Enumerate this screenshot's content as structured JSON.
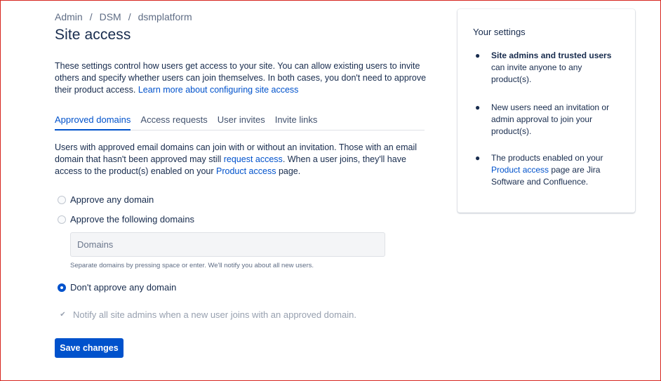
{
  "breadcrumb": [
    "Admin",
    "DSM",
    "dsmplatform"
  ],
  "breadcrumb_separator": "/",
  "page_title": "Site access",
  "intro": {
    "text": "These settings control how users get access to your site. You can allow existing users to invite others and specify whether users can join themselves. In both cases, you don't need to approve their product access. ",
    "link": "Learn more about configuring site access"
  },
  "tabs": [
    {
      "label": "Approved domains",
      "active": true
    },
    {
      "label": "Access requests",
      "active": false
    },
    {
      "label": "User invites",
      "active": false
    },
    {
      "label": "Invite links",
      "active": false
    }
  ],
  "description": {
    "part1": "Users with approved email domains can join with or without an invitation. Those with an email domain that hasn't been approved may still ",
    "link1": "request access",
    "part2": ". When a user joins, they'll have access to the product(s) enabled on your ",
    "link2": "Product access",
    "part3": " page."
  },
  "options": {
    "any_domain": {
      "label": "Approve any domain",
      "checked": false
    },
    "following_domains": {
      "label": "Approve the following domains",
      "checked": false
    },
    "no_domain": {
      "label": "Don't approve any domain",
      "checked": true
    }
  },
  "domains_input": {
    "placeholder": "Domains",
    "value": ""
  },
  "domains_helper": "Separate domains by pressing space or enter. We'll notify you about all new users.",
  "notify_checkbox": {
    "label": "Notify all site admins when a new user joins with an approved domain.",
    "checked": true,
    "disabled": true
  },
  "save_button": "Save changes",
  "settings_panel": {
    "title": "Your settings",
    "item1_bold": "Site admins and trusted users",
    "item1_rest": " can invite anyone to any product(s).",
    "item2": "New users need an invitation or admin approval to join your product(s).",
    "item3_part1": "The products enabled on your ",
    "item3_link": "Product access",
    "item3_part2": " page are Jira Software and Confluence."
  },
  "colors": {
    "accent": "#0052cc",
    "text": "#172b4d",
    "subtle_text": "#5e6c84",
    "frame_border": "#d6261f"
  }
}
